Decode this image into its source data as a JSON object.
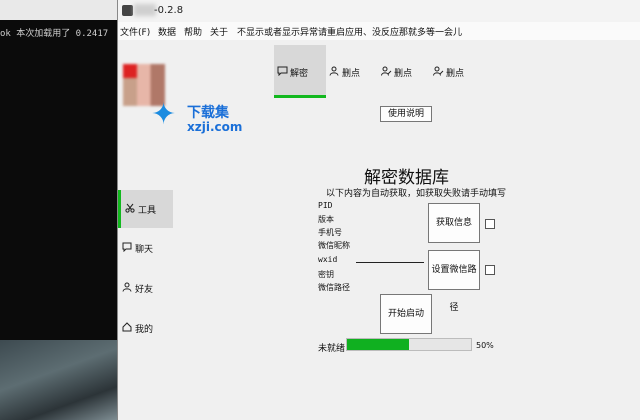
{
  "terminal": {
    "text": "ok 本次加载用了 0.2417"
  },
  "window": {
    "title": "-0.2.8"
  },
  "menu": [
    "文件(F)",
    "数据",
    "帮助",
    "关于",
    "不显示或者显示异常请重启应用、没反应那就多等一会儿"
  ],
  "watermark": {
    "line1": "下载集",
    "line2": "xzji.com"
  },
  "sidebar": [
    {
      "label": "工具",
      "icon": "scissors-icon",
      "active": true
    },
    {
      "label": "聊天",
      "icon": "chat-icon",
      "active": false
    },
    {
      "label": "好友",
      "icon": "user-icon",
      "active": false
    },
    {
      "label": "我的",
      "icon": "home-icon",
      "active": false
    }
  ],
  "tabs": [
    {
      "label": "解密",
      "icon": "chat-icon",
      "active": true
    },
    {
      "label": "删点",
      "icon": "user-icon",
      "active": false
    },
    {
      "label": "删点",
      "icon": "user-pen-icon",
      "active": false
    },
    {
      "label": "删点",
      "icon": "user-pen-icon",
      "active": false
    }
  ],
  "help_button": "使用说明",
  "heading": "解密数据库",
  "subtitle": "以下内容为自动获取，如获取失败请手动填写",
  "fields": [
    "PID",
    "版本",
    "手机号",
    "微信昵称",
    "wxid",
    "密钥",
    "微信路径"
  ],
  "buttons": {
    "get_info": "获取信息",
    "set_path": "设置微信路径",
    "start": "开始启动"
  },
  "status": {
    "label": "未就绪",
    "progress": 0.5,
    "percent_text": "50%"
  },
  "colors": {
    "accent": "#12b81e",
    "progress": "#10b020"
  }
}
